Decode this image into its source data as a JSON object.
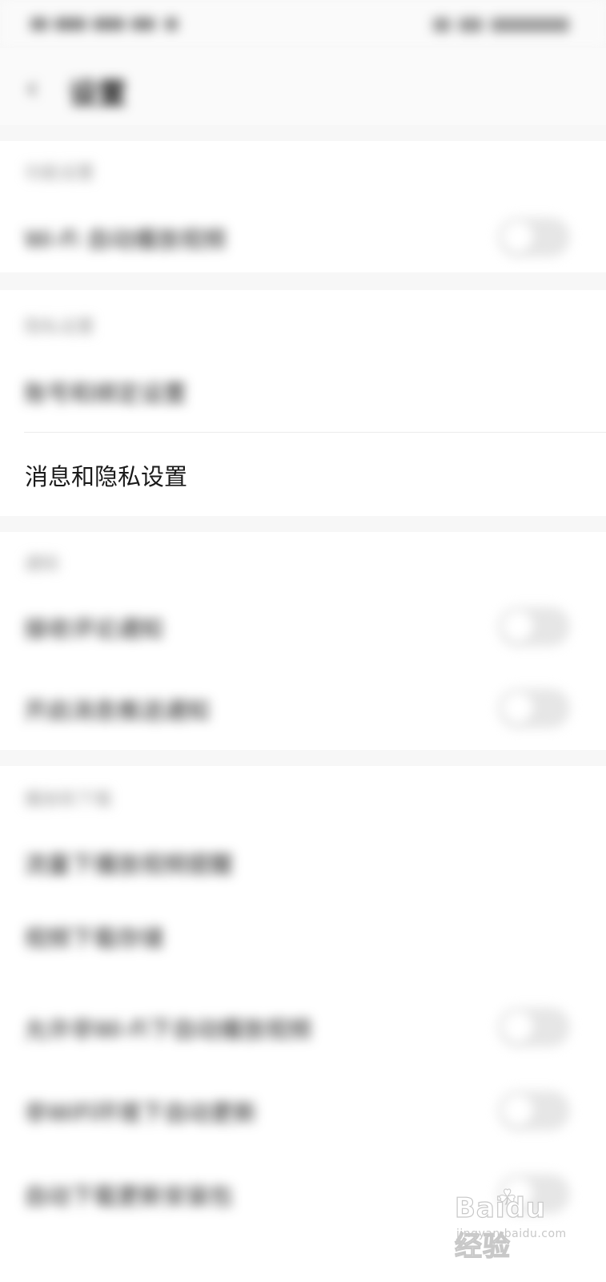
{
  "status_bar": {
    "left_text": "",
    "right_text": ""
  },
  "header": {
    "title": "设置"
  },
  "sections": [
    {
      "header": "功能设置",
      "rows": [
        {
          "label": "Wi-Fi 自动播放视频",
          "toggle": false
        }
      ]
    },
    {
      "header": "隐私设置",
      "rows": [
        {
          "label": "账号和绑定设置",
          "toggle": null
        },
        {
          "label": "消息和隐私设置",
          "toggle": null
        }
      ]
    },
    {
      "header": "通知",
      "rows": [
        {
          "label": "接收评论通知",
          "toggle": false
        },
        {
          "label": "开启消息推送通知",
          "toggle": false
        }
      ]
    },
    {
      "header": "播放和下载",
      "rows": [
        {
          "label": "流量下播放视频提醒",
          "toggle": null
        },
        {
          "label": "视频下载存储",
          "sublabel": "",
          "toggle": null
        },
        {
          "label": "允许非Wi-Fi下自动播放视频",
          "toggle": false
        },
        {
          "label": "非WiFi环境下自动更新",
          "toggle": false
        },
        {
          "label": "自动下载更新安装包",
          "toggle": false
        }
      ]
    }
  ],
  "watermark": {
    "brand": "Baidu经验",
    "sub": "jingyan.baidu.com"
  },
  "colors": {
    "background": "#f7f7f7",
    "section_bg": "#ffffff",
    "toggle_off": "#e6e6e6"
  }
}
